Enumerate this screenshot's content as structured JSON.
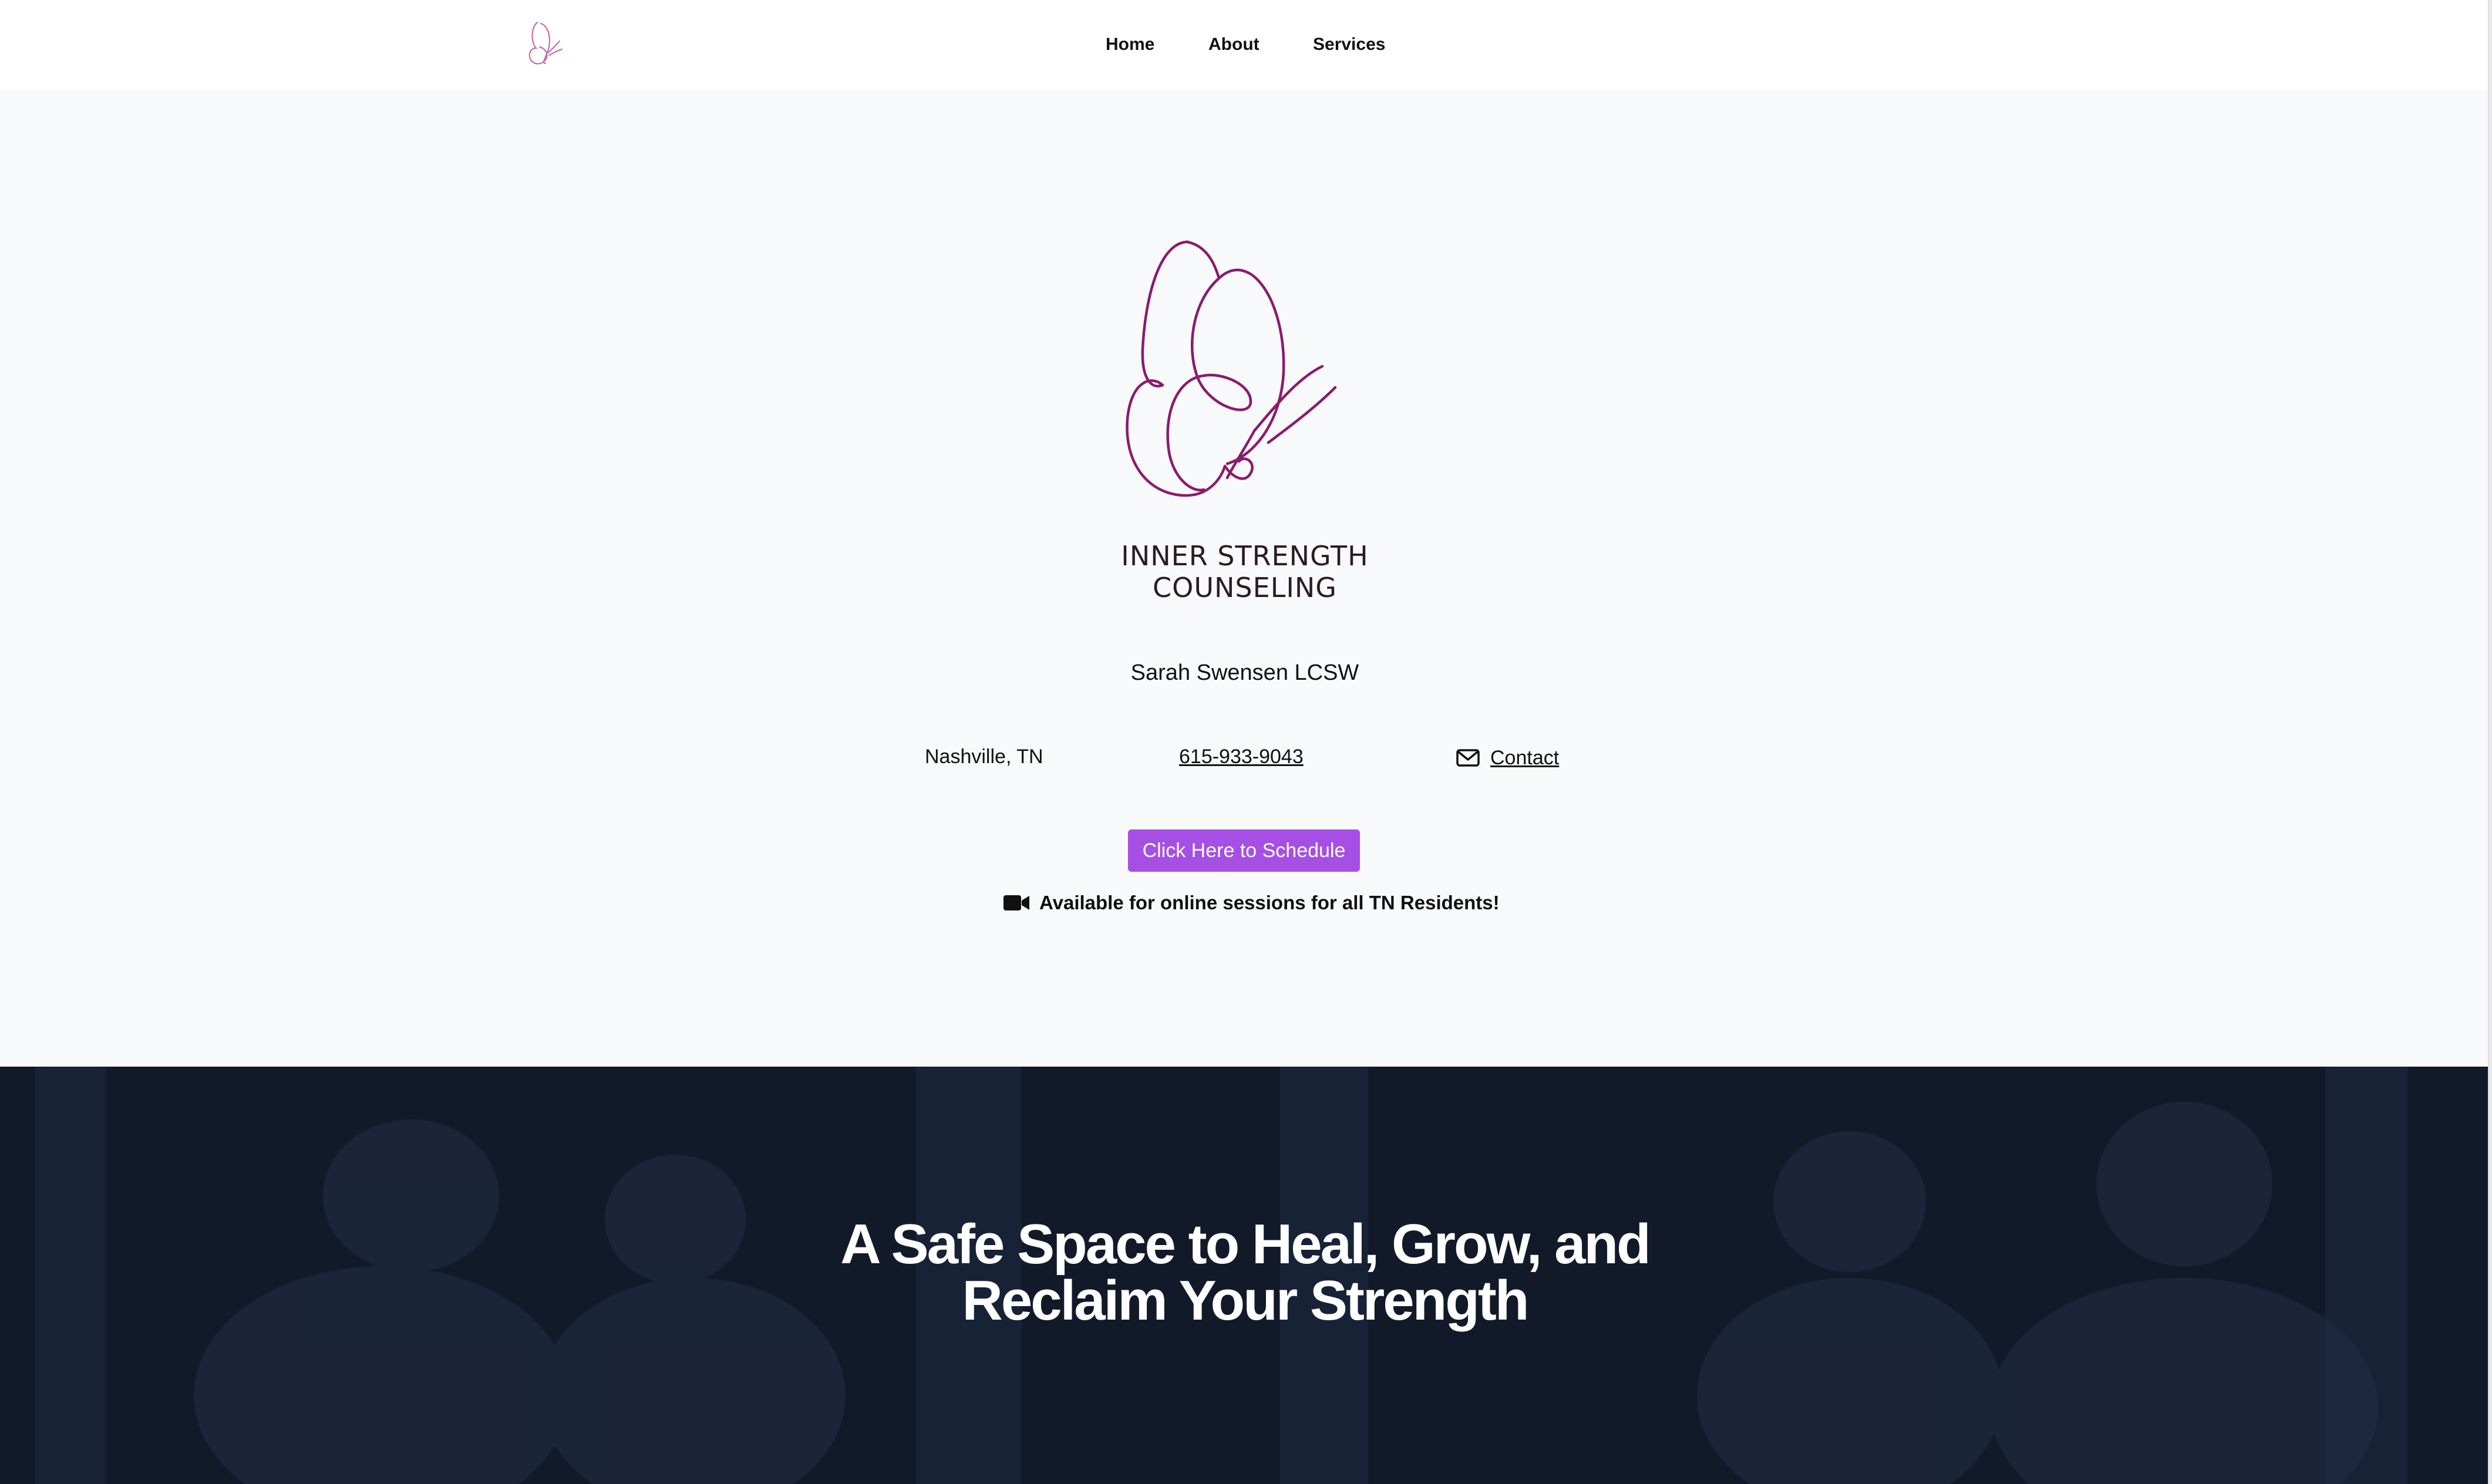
{
  "nav": {
    "items": [
      {
        "label": "Home"
      },
      {
        "label": "About"
      },
      {
        "label": "Services"
      }
    ]
  },
  "brand": {
    "name_line1": "INNER STRENGTH",
    "name_line2": "COUNSELING",
    "logo_color": "#8b1a6e",
    "header_logo_color": "#c66bb3"
  },
  "hero": {
    "owner": "Sarah Swensen LCSW",
    "location": "Nashville, TN",
    "phone": "615-933-9043",
    "contact_label": "Contact",
    "contact_icon": "mail-icon",
    "schedule_button": "Click Here to Schedule",
    "online_note": "Available for online sessions for all TN Residents!",
    "online_icon": "video-camera-icon",
    "accent_color": "#a64fe5",
    "background": "#f8f9fa"
  },
  "banner": {
    "title_line1": "A Safe Space to Heal, Grow, and",
    "title_line2": "Reclaim Your Strength",
    "background": "#121a2a"
  }
}
